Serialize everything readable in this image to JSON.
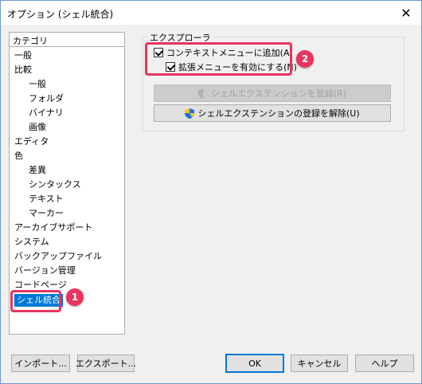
{
  "window": {
    "title": "オプション (シェル統合)",
    "close_glyph": "✕"
  },
  "sidebar": {
    "header": "カテゴリ",
    "items": [
      {
        "label": "一般"
      },
      {
        "label": "比較"
      },
      {
        "label": "一般"
      },
      {
        "label": "フォルダ"
      },
      {
        "label": "バイナリ"
      },
      {
        "label": "画像"
      },
      {
        "label": "エディタ"
      },
      {
        "label": "色"
      },
      {
        "label": "差異"
      },
      {
        "label": "シンタックス"
      },
      {
        "label": "テキスト"
      },
      {
        "label": "マーカー"
      },
      {
        "label": "アーカイブサポート"
      },
      {
        "label": "システム"
      },
      {
        "label": "バックアップファイル"
      },
      {
        "label": "バージョン管理"
      },
      {
        "label": "コードページ"
      },
      {
        "label": "シェル統合"
      }
    ],
    "selected": "シェル統合"
  },
  "explorer": {
    "group_label": "エクスプローラ",
    "context_menu": {
      "label": "コンテキストメニューに追加(A)",
      "checked": true
    },
    "extended_menu": {
      "label": "拡張メニューを有効にする(N)",
      "checked": true
    },
    "register_button": "シェルエクステンションを登録(R)",
    "unregister_button": "シェルエクステンションの登録を解除(U)"
  },
  "footer": {
    "import_button": "インポート...",
    "export_button": "エクスポート...",
    "ok_button": "OK",
    "cancel_button": "キャンセル",
    "help_button": "ヘルプ"
  },
  "annotations": {
    "badge1": "1",
    "badge2": "2",
    "highlight_color": "#e8345e"
  },
  "colors": {
    "selection": "#0078d7",
    "accent": "#e8345e"
  },
  "icons": {
    "shield": "uac-shield-icon"
  }
}
